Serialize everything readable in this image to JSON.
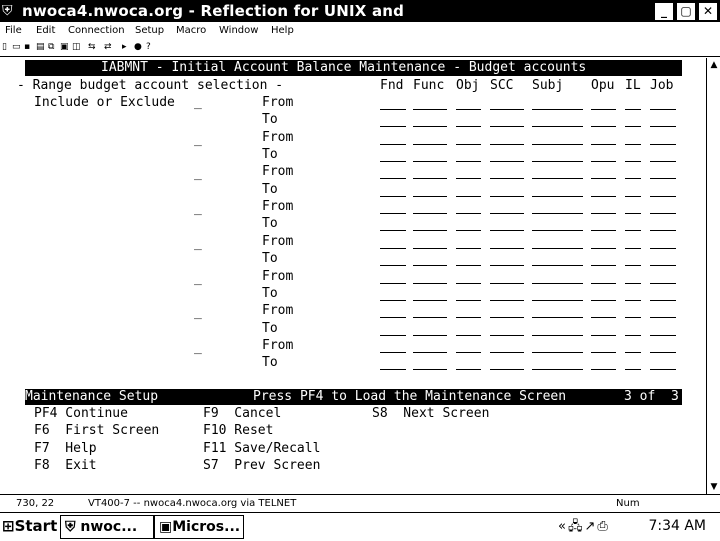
{
  "window": {
    "title": "nwoca4.nwoca.org - Reflection for UNIX and",
    "minimize": "_",
    "restore": "▢",
    "close": "✕"
  },
  "menu": [
    "File",
    "Edit",
    "Connection",
    "Setup",
    "Macro",
    "Window",
    "Help"
  ],
  "screen": {
    "header": "IABMNT - Initial Account Balance Maintenance - Budget accounts",
    "range_label": "- Range budget account selection -",
    "include_label": "Include or Exclude",
    "columns": [
      "Fnd",
      "Func",
      "Obj",
      "SCC",
      "Subj",
      "Opu",
      "IL",
      "Job"
    ],
    "from_label": "From",
    "to_label": "To",
    "selection_marker": "_",
    "bar_left": "Maintenance Setup",
    "bar_middle": "Press PF4 to Load the Maintenance Screen",
    "bar_right": "3 of  3",
    "keys_col1": [
      "PF4 Continue",
      "F6  First Screen",
      "F7  Help",
      "F8  Exit"
    ],
    "keys_col2": [
      "F9  Cancel",
      "F10 Reset",
      "F11 Save/Recall",
      "S7  Prev Screen"
    ],
    "keys_col3": [
      "S8  Next Screen"
    ]
  },
  "status": {
    "cursor": "730, 22",
    "session": "VT400-7 -- nwoca4.nwoca.org via TELNET",
    "num": "Num"
  },
  "taskbar": {
    "start": "Start",
    "task1": "nwoc...",
    "task2": "Micros...",
    "clock": "7:34 AM"
  }
}
